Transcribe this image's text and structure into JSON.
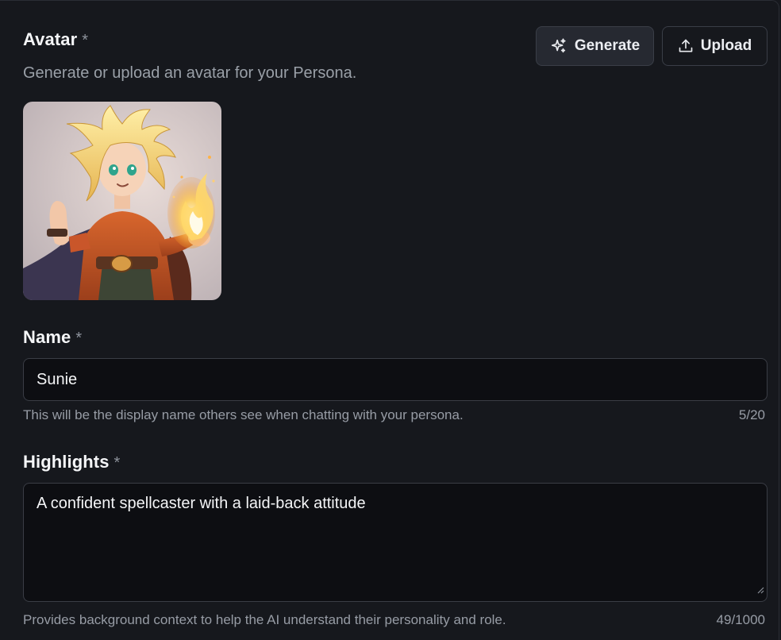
{
  "avatar_section": {
    "label": "Avatar",
    "required_mark": "*",
    "description": "Generate or upload an avatar for your Persona.",
    "generate_label": "Generate",
    "upload_label": "Upload",
    "image_icon": "avatar-illustration-fire-mage"
  },
  "name_section": {
    "label": "Name",
    "required_mark": "*",
    "value": "Sunie",
    "helper": "This will be the display name others see when chatting with your persona.",
    "count": "5/20"
  },
  "highlights_section": {
    "label": "Highlights",
    "required_mark": "*",
    "value": "A confident spellcaster with a laid-back attitude",
    "helper": "Provides background context to help the AI understand their personality and role.",
    "count": "49/1000"
  },
  "colors": {
    "background": "#16181d",
    "input_background": "#0d0e12",
    "border": "#3a3d45",
    "muted_text": "#979ca5"
  }
}
